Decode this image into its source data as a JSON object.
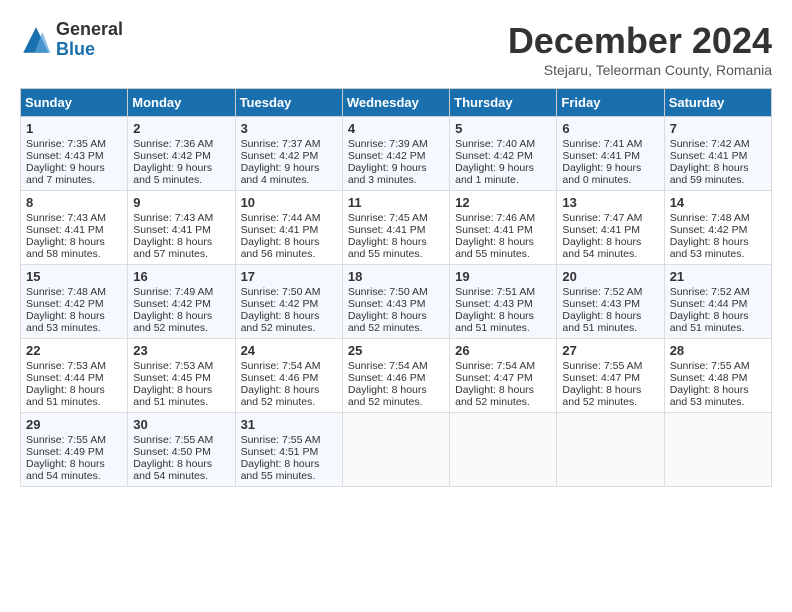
{
  "logo": {
    "general": "General",
    "blue": "Blue"
  },
  "title": "December 2024",
  "subtitle": "Stejaru, Teleorman County, Romania",
  "days_of_week": [
    "Sunday",
    "Monday",
    "Tuesday",
    "Wednesday",
    "Thursday",
    "Friday",
    "Saturday"
  ],
  "weeks": [
    [
      {
        "day": "1",
        "rise": "Sunrise: 7:35 AM",
        "set": "Sunset: 4:43 PM",
        "daylight": "Daylight: 9 hours and 7 minutes."
      },
      {
        "day": "2",
        "rise": "Sunrise: 7:36 AM",
        "set": "Sunset: 4:42 PM",
        "daylight": "Daylight: 9 hours and 5 minutes."
      },
      {
        "day": "3",
        "rise": "Sunrise: 7:37 AM",
        "set": "Sunset: 4:42 PM",
        "daylight": "Daylight: 9 hours and 4 minutes."
      },
      {
        "day": "4",
        "rise": "Sunrise: 7:39 AM",
        "set": "Sunset: 4:42 PM",
        "daylight": "Daylight: 9 hours and 3 minutes."
      },
      {
        "day": "5",
        "rise": "Sunrise: 7:40 AM",
        "set": "Sunset: 4:42 PM",
        "daylight": "Daylight: 9 hours and 1 minute."
      },
      {
        "day": "6",
        "rise": "Sunrise: 7:41 AM",
        "set": "Sunset: 4:41 PM",
        "daylight": "Daylight: 9 hours and 0 minutes."
      },
      {
        "day": "7",
        "rise": "Sunrise: 7:42 AM",
        "set": "Sunset: 4:41 PM",
        "daylight": "Daylight: 8 hours and 59 minutes."
      }
    ],
    [
      {
        "day": "8",
        "rise": "Sunrise: 7:43 AM",
        "set": "Sunset: 4:41 PM",
        "daylight": "Daylight: 8 hours and 58 minutes."
      },
      {
        "day": "9",
        "rise": "Sunrise: 7:43 AM",
        "set": "Sunset: 4:41 PM",
        "daylight": "Daylight: 8 hours and 57 minutes."
      },
      {
        "day": "10",
        "rise": "Sunrise: 7:44 AM",
        "set": "Sunset: 4:41 PM",
        "daylight": "Daylight: 8 hours and 56 minutes."
      },
      {
        "day": "11",
        "rise": "Sunrise: 7:45 AM",
        "set": "Sunset: 4:41 PM",
        "daylight": "Daylight: 8 hours and 55 minutes."
      },
      {
        "day": "12",
        "rise": "Sunrise: 7:46 AM",
        "set": "Sunset: 4:41 PM",
        "daylight": "Daylight: 8 hours and 55 minutes."
      },
      {
        "day": "13",
        "rise": "Sunrise: 7:47 AM",
        "set": "Sunset: 4:41 PM",
        "daylight": "Daylight: 8 hours and 54 minutes."
      },
      {
        "day": "14",
        "rise": "Sunrise: 7:48 AM",
        "set": "Sunset: 4:42 PM",
        "daylight": "Daylight: 8 hours and 53 minutes."
      }
    ],
    [
      {
        "day": "15",
        "rise": "Sunrise: 7:48 AM",
        "set": "Sunset: 4:42 PM",
        "daylight": "Daylight: 8 hours and 53 minutes."
      },
      {
        "day": "16",
        "rise": "Sunrise: 7:49 AM",
        "set": "Sunset: 4:42 PM",
        "daylight": "Daylight: 8 hours and 52 minutes."
      },
      {
        "day": "17",
        "rise": "Sunrise: 7:50 AM",
        "set": "Sunset: 4:42 PM",
        "daylight": "Daylight: 8 hours and 52 minutes."
      },
      {
        "day": "18",
        "rise": "Sunrise: 7:50 AM",
        "set": "Sunset: 4:43 PM",
        "daylight": "Daylight: 8 hours and 52 minutes."
      },
      {
        "day": "19",
        "rise": "Sunrise: 7:51 AM",
        "set": "Sunset: 4:43 PM",
        "daylight": "Daylight: 8 hours and 51 minutes."
      },
      {
        "day": "20",
        "rise": "Sunrise: 7:52 AM",
        "set": "Sunset: 4:43 PM",
        "daylight": "Daylight: 8 hours and 51 minutes."
      },
      {
        "day": "21",
        "rise": "Sunrise: 7:52 AM",
        "set": "Sunset: 4:44 PM",
        "daylight": "Daylight: 8 hours and 51 minutes."
      }
    ],
    [
      {
        "day": "22",
        "rise": "Sunrise: 7:53 AM",
        "set": "Sunset: 4:44 PM",
        "daylight": "Daylight: 8 hours and 51 minutes."
      },
      {
        "day": "23",
        "rise": "Sunrise: 7:53 AM",
        "set": "Sunset: 4:45 PM",
        "daylight": "Daylight: 8 hours and 51 minutes."
      },
      {
        "day": "24",
        "rise": "Sunrise: 7:54 AM",
        "set": "Sunset: 4:46 PM",
        "daylight": "Daylight: 8 hours and 52 minutes."
      },
      {
        "day": "25",
        "rise": "Sunrise: 7:54 AM",
        "set": "Sunset: 4:46 PM",
        "daylight": "Daylight: 8 hours and 52 minutes."
      },
      {
        "day": "26",
        "rise": "Sunrise: 7:54 AM",
        "set": "Sunset: 4:47 PM",
        "daylight": "Daylight: 8 hours and 52 minutes."
      },
      {
        "day": "27",
        "rise": "Sunrise: 7:55 AM",
        "set": "Sunset: 4:47 PM",
        "daylight": "Daylight: 8 hours and 52 minutes."
      },
      {
        "day": "28",
        "rise": "Sunrise: 7:55 AM",
        "set": "Sunset: 4:48 PM",
        "daylight": "Daylight: 8 hours and 53 minutes."
      }
    ],
    [
      {
        "day": "29",
        "rise": "Sunrise: 7:55 AM",
        "set": "Sunset: 4:49 PM",
        "daylight": "Daylight: 8 hours and 54 minutes."
      },
      {
        "day": "30",
        "rise": "Sunrise: 7:55 AM",
        "set": "Sunset: 4:50 PM",
        "daylight": "Daylight: 8 hours and 54 minutes."
      },
      {
        "day": "31",
        "rise": "Sunrise: 7:55 AM",
        "set": "Sunset: 4:51 PM",
        "daylight": "Daylight: 8 hours and 55 minutes."
      },
      null,
      null,
      null,
      null
    ]
  ]
}
